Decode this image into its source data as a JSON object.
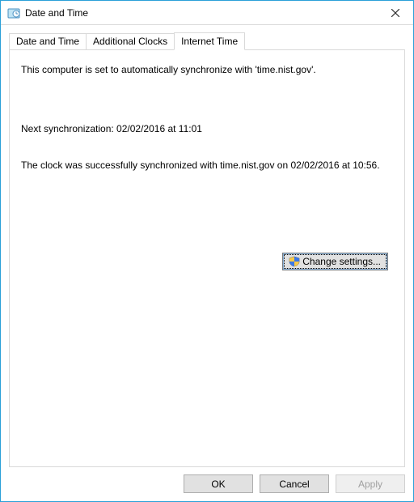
{
  "window": {
    "title": "Date and Time"
  },
  "tabs": [
    {
      "label": "Date and Time"
    },
    {
      "label": "Additional Clocks"
    },
    {
      "label": "Internet Time"
    }
  ],
  "content": {
    "sync_server_msg": "This computer is set to automatically synchronize with 'time.nist.gov'.",
    "next_sync_msg": "Next synchronization: 02/02/2016 at 11:01",
    "last_sync_msg": "The clock was successfully synchronized with time.nist.gov on 02/02/2016 at 10:56.",
    "change_settings_label": "Change settings..."
  },
  "buttons": {
    "ok": "OK",
    "cancel": "Cancel",
    "apply": "Apply"
  }
}
